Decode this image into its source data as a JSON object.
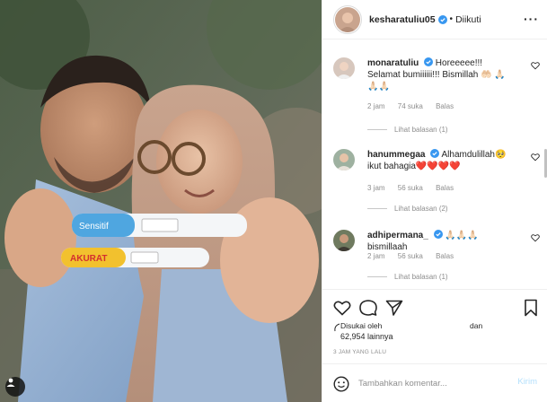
{
  "post": {
    "username": "kesharatuliu05",
    "separator": "•",
    "follow_status": "Diikuti"
  },
  "comments": [
    {
      "username": "monaratuliu",
      "text": "Horeeeee!!! Selamat bumiiiiii!!! Bismillah 🤲🏻 🙏🏻🙏🏻🙏🏻",
      "time": "2 jam",
      "likes": "74 suka",
      "reply": "Balas",
      "view_replies": "Lihat balasan (1)"
    },
    {
      "username": "hanummegaa",
      "text": "Alhamdulillah🥺 ikut bahagia❤️❤️❤️❤️",
      "time": "3 jam",
      "likes": "56 suka",
      "reply": "Balas",
      "view_replies": "Lihat balasan (2)"
    },
    {
      "username": "adhipermana_",
      "text": "🙏🏻🙏🏻🙏🏻 bismillaah",
      "time": "2 jam",
      "likes": "56 suka",
      "reply": "Balas",
      "view_replies": "Lihat balasan (1)"
    }
  ],
  "likes": {
    "liked_by": "Disukai oleh",
    "and": "dan",
    "count": "62,954 lainnya"
  },
  "time_ago": "3 JAM YANG LALU",
  "composer": {
    "placeholder": "Tambahkan komentar...",
    "post_label": "Kirim"
  },
  "photo_labels": {
    "test_top": "Sensitif",
    "test_bottom": "AKURAT"
  },
  "colors": {
    "verified": "#3897f0",
    "muted": "#8e8e8e",
    "post_disabled": "#b2dffc",
    "border": "#efefef"
  }
}
